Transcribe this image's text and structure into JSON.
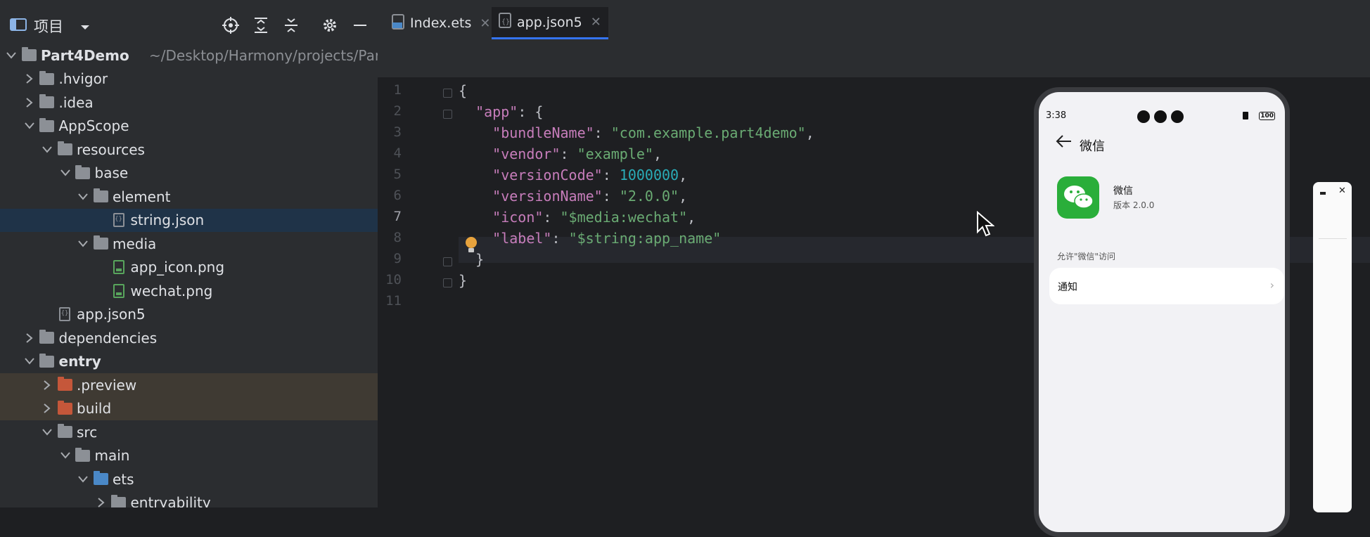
{
  "project_panel": {
    "title": "项目",
    "tree": [
      {
        "label": "Part4Demo",
        "path": "~/Desktop/Harmony/projects/Part",
        "kind": "project",
        "expanded": true,
        "depth": 0,
        "bold": true
      },
      {
        "label": ".hvigor",
        "kind": "folder",
        "expanded": false,
        "depth": 1
      },
      {
        "label": ".idea",
        "kind": "folder",
        "expanded": false,
        "depth": 1
      },
      {
        "label": "AppScope",
        "kind": "folder",
        "expanded": true,
        "depth": 1
      },
      {
        "label": "resources",
        "kind": "folder",
        "expanded": true,
        "depth": 2
      },
      {
        "label": "base",
        "kind": "folder",
        "expanded": true,
        "depth": 3
      },
      {
        "label": "element",
        "kind": "folder",
        "expanded": true,
        "depth": 4
      },
      {
        "label": "string.json",
        "kind": "json",
        "depth": 5,
        "selected": true
      },
      {
        "label": "media",
        "kind": "folder",
        "expanded": true,
        "depth": 4
      },
      {
        "label": "app_icon.png",
        "kind": "png",
        "depth": 5
      },
      {
        "label": "wechat.png",
        "kind": "png",
        "depth": 5
      },
      {
        "label": "app.json5",
        "kind": "json",
        "depth": 2
      },
      {
        "label": "dependencies",
        "kind": "folder",
        "expanded": false,
        "depth": 1
      },
      {
        "label": "entry",
        "kind": "folder",
        "expanded": true,
        "depth": 1,
        "bold": true
      },
      {
        "label": ".preview",
        "kind": "folder-orange",
        "expanded": false,
        "depth": 2,
        "excluded": true
      },
      {
        "label": "build",
        "kind": "folder-orange",
        "expanded": false,
        "depth": 2,
        "excluded": true
      },
      {
        "label": "src",
        "kind": "folder",
        "expanded": true,
        "depth": 2
      },
      {
        "label": "main",
        "kind": "folder",
        "expanded": true,
        "depth": 3
      },
      {
        "label": "ets",
        "kind": "folder-blue",
        "expanded": true,
        "depth": 4
      },
      {
        "label": "entryability",
        "kind": "folder",
        "expanded": false,
        "depth": 5
      }
    ]
  },
  "tabs": [
    {
      "label": "Index.ets",
      "active": false
    },
    {
      "label": "app.json5",
      "active": true
    }
  ],
  "editor": {
    "current_line": 7,
    "lines": [
      {
        "n": "1",
        "tokens": [
          {
            "t": "{",
            "c": "p"
          }
        ]
      },
      {
        "n": "2",
        "tokens": [
          {
            "t": "  ",
            "c": "p"
          },
          {
            "t": "\"app\"",
            "c": "k"
          },
          {
            "t": ": {",
            "c": "p"
          }
        ]
      },
      {
        "n": "3",
        "tokens": [
          {
            "t": "    ",
            "c": "p"
          },
          {
            "t": "\"bundleName\"",
            "c": "k"
          },
          {
            "t": ": ",
            "c": "p"
          },
          {
            "t": "\"com.example.part4demo\"",
            "c": "s"
          },
          {
            "t": ",",
            "c": "p"
          }
        ]
      },
      {
        "n": "4",
        "tokens": [
          {
            "t": "    ",
            "c": "p"
          },
          {
            "t": "\"vendor\"",
            "c": "k"
          },
          {
            "t": ": ",
            "c": "p"
          },
          {
            "t": "\"example\"",
            "c": "s"
          },
          {
            "t": ",",
            "c": "p"
          }
        ]
      },
      {
        "n": "5",
        "tokens": [
          {
            "t": "    ",
            "c": "p"
          },
          {
            "t": "\"versionCode\"",
            "c": "k"
          },
          {
            "t": ": ",
            "c": "p"
          },
          {
            "t": "1000000",
            "c": "n"
          },
          {
            "t": ",",
            "c": "p"
          }
        ]
      },
      {
        "n": "6",
        "tokens": [
          {
            "t": "    ",
            "c": "p"
          },
          {
            "t": "\"versionName\"",
            "c": "k"
          },
          {
            "t": ": ",
            "c": "p"
          },
          {
            "t": "\"2.0.0\"",
            "c": "s"
          },
          {
            "t": ",",
            "c": "p"
          }
        ]
      },
      {
        "n": "7",
        "tokens": [
          {
            "t": "    ",
            "c": "p"
          },
          {
            "t": "\"icon\"",
            "c": "k"
          },
          {
            "t": ": ",
            "c": "p"
          },
          {
            "t": "\"$media:wechat\"",
            "c": "s"
          },
          {
            "t": ",",
            "c": "p"
          }
        ]
      },
      {
        "n": "8",
        "tokens": [
          {
            "t": "    ",
            "c": "p"
          },
          {
            "t": "\"label\"",
            "c": "k"
          },
          {
            "t": ": ",
            "c": "p"
          },
          {
            "t": "\"$string:app_name\"",
            "c": "s"
          }
        ]
      },
      {
        "n": "9",
        "tokens": [
          {
            "t": "  }",
            "c": "p"
          }
        ]
      },
      {
        "n": "10",
        "tokens": [
          {
            "t": "}",
            "c": "p"
          }
        ]
      },
      {
        "n": "11",
        "tokens": []
      }
    ]
  },
  "phone": {
    "time": "3:38",
    "battery": "100",
    "page_title": "微信",
    "app_name": "微信",
    "app_version": "版本 2.0.0",
    "permission_heading": "允许\"微信\"访问",
    "notification_label": "通知"
  },
  "colors": {
    "accent": "#3574f0",
    "wechat_green": "#2aae3a"
  }
}
